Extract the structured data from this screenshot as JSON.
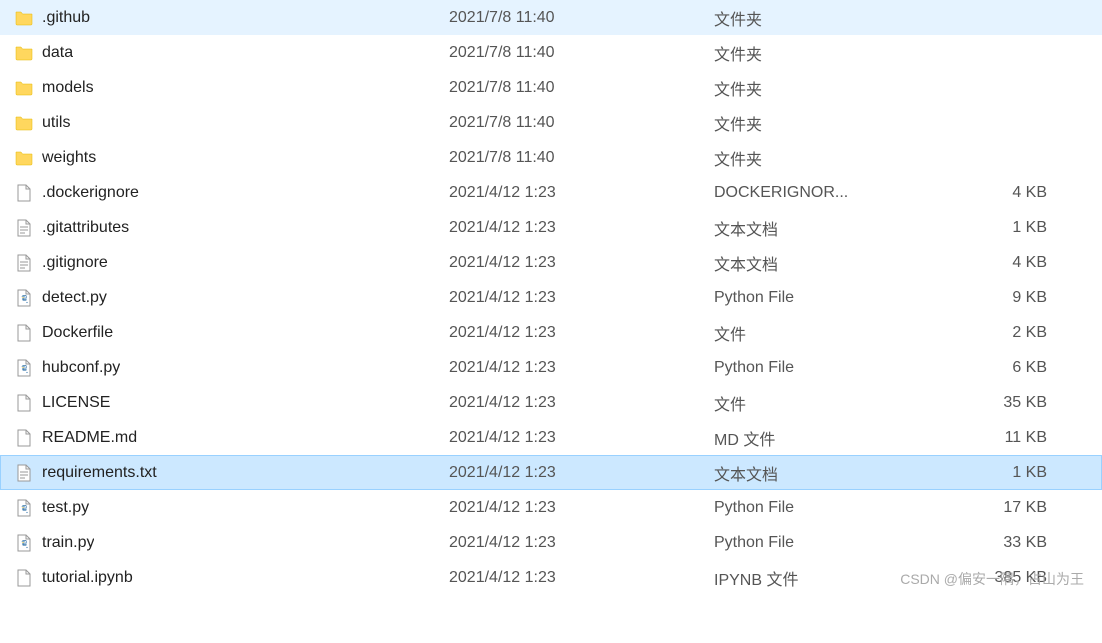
{
  "files": [
    {
      "name": ".github",
      "date": "2021/7/8 11:40",
      "type": "文件夹",
      "size": "",
      "icon": "folder"
    },
    {
      "name": "data",
      "date": "2021/7/8 11:40",
      "type": "文件夹",
      "size": "",
      "icon": "folder"
    },
    {
      "name": "models",
      "date": "2021/7/8 11:40",
      "type": "文件夹",
      "size": "",
      "icon": "folder"
    },
    {
      "name": "utils",
      "date": "2021/7/8 11:40",
      "type": "文件夹",
      "size": "",
      "icon": "folder"
    },
    {
      "name": "weights",
      "date": "2021/7/8 11:40",
      "type": "文件夹",
      "size": "",
      "icon": "folder"
    },
    {
      "name": ".dockerignore",
      "date": "2021/4/12 1:23",
      "type": "DOCKERIGNOR...",
      "size": "4 KB",
      "icon": "file"
    },
    {
      "name": ".gitattributes",
      "date": "2021/4/12 1:23",
      "type": "文本文档",
      "size": "1 KB",
      "icon": "text"
    },
    {
      "name": ".gitignore",
      "date": "2021/4/12 1:23",
      "type": "文本文档",
      "size": "4 KB",
      "icon": "text"
    },
    {
      "name": "detect.py",
      "date": "2021/4/12 1:23",
      "type": "Python File",
      "size": "9 KB",
      "icon": "python"
    },
    {
      "name": "Dockerfile",
      "date": "2021/4/12 1:23",
      "type": "文件",
      "size": "2 KB",
      "icon": "file"
    },
    {
      "name": "hubconf.py",
      "date": "2021/4/12 1:23",
      "type": "Python File",
      "size": "6 KB",
      "icon": "python"
    },
    {
      "name": "LICENSE",
      "date": "2021/4/12 1:23",
      "type": "文件",
      "size": "35 KB",
      "icon": "file"
    },
    {
      "name": "README.md",
      "date": "2021/4/12 1:23",
      "type": "MD 文件",
      "size": "11 KB",
      "icon": "file"
    },
    {
      "name": "requirements.txt",
      "date": "2021/4/12 1:23",
      "type": "文本文档",
      "size": "1 KB",
      "icon": "text",
      "selected": true
    },
    {
      "name": "test.py",
      "date": "2021/4/12 1:23",
      "type": "Python File",
      "size": "17 KB",
      "icon": "python"
    },
    {
      "name": "train.py",
      "date": "2021/4/12 1:23",
      "type": "Python File",
      "size": "33 KB",
      "icon": "python"
    },
    {
      "name": "tutorial.ipynb",
      "date": "2021/4/12 1:23",
      "type": "IPYNB 文件",
      "size": "385 KB",
      "icon": "file"
    }
  ],
  "watermark": "CSDN @偏安一隅，占山为王"
}
